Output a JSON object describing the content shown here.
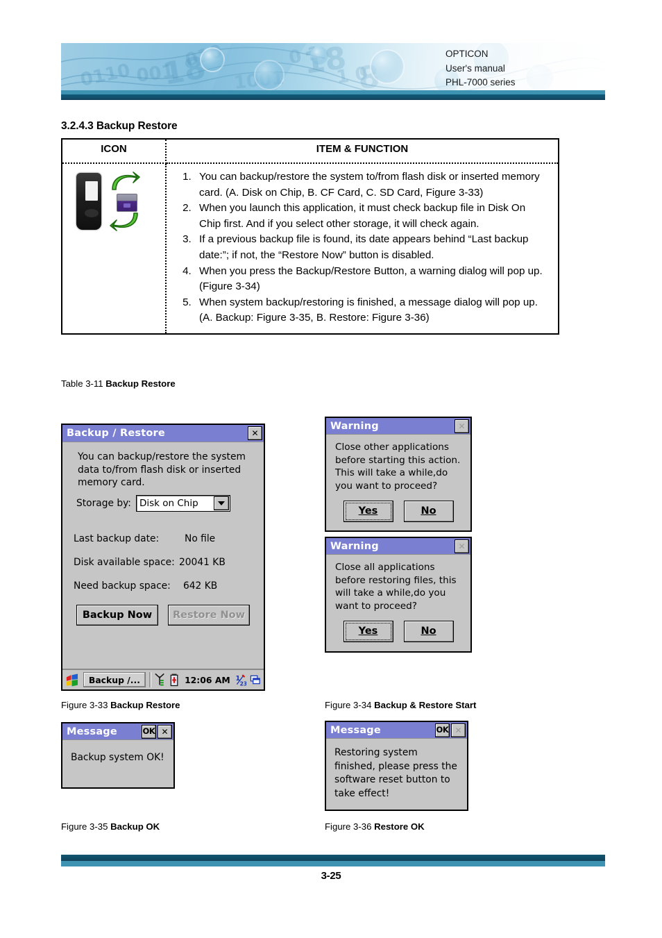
{
  "header": {
    "company": "OPTICON",
    "manual": "User's manual",
    "series": "PHL-7000 series",
    "banner_alt": "blue-circuit-binary-banner"
  },
  "section": {
    "heading": "3.2.4.3 Backup Restore"
  },
  "table": {
    "columns": [
      "ICON",
      "ITEM & FUNCTION"
    ],
    "icon_name": "backup-restore-device-sync-icon",
    "items": [
      "You can backup/restore the system to/from flash disk or inserted memory card. (A. Disk on Chip, B. CF Card, C. SD Card, Figure 3-33)",
      "When you launch this application, it must check backup file in Disk On Chip first. And if you select other storage, it will check again.",
      "If a previous backup file is found, its date appears behind “Last backup date:”; if not, the “Restore Now” button is disabled.",
      "When you press the Backup/Restore Button, a warning dialog will pop up. (Figure 3-34)",
      "When system backup/restoring is finished, a message dialog will pop up. (A. Backup: Figure 3-35, B. Restore: Figure 3-36)"
    ],
    "caption_prefix": "Table 3-11 ",
    "caption_bold": "Backup Restore"
  },
  "fig33": {
    "title": "Backup / Restore",
    "close_label": "✕",
    "intro": "You can backup/restore the system data to/from flash disk or inserted memory card.",
    "storage_label": "Storage by:",
    "storage_value": "Disk on Chip",
    "rows": [
      {
        "key": "Last backup date:",
        "value": "No file"
      },
      {
        "key": "Disk available space:",
        "value": "20041 KB"
      },
      {
        "key": "Need backup space:",
        "value": "642 KB"
      }
    ],
    "backup_button": "Backup Now",
    "restore_button": "Restore Now",
    "taskbar": {
      "start_icon": "windows-start-flag-icon",
      "task_label": "Backup /...",
      "signal_icon": "antenna-signal-icon",
      "battery_icon": "battery-icon",
      "clock": "12:06 AM",
      "input_icon": "handwriting-input-icon",
      "desktop_icon": "show-desktop-icon"
    },
    "caption_prefix": "Figure 3-33 ",
    "caption_bold": "Backup Restore"
  },
  "fig34": {
    "caption_prefix": "Figure 3-34 ",
    "caption_bold": "Backup & Restore Start",
    "dialog_a": {
      "title": "Warning",
      "close_label": "✕",
      "text": "Close other applications before starting this action. This will take a while,do you want to proceed?",
      "yes_button": "Yes",
      "no_button": "No"
    },
    "dialog_b": {
      "title": "Warning",
      "close_label": "✕",
      "text": "Close all applications before restoring files, this will take a while,do you want to proceed?",
      "yes_button": "Yes",
      "no_button": "No"
    }
  },
  "fig35": {
    "title": "Message",
    "ok_label": "OK",
    "close_label": "✕",
    "text": "Backup system OK!",
    "caption_prefix": "Figure 3-35 ",
    "caption_bold": "Backup OK"
  },
  "fig36": {
    "title": "Message",
    "ok_label": "OK",
    "close_label": "✕",
    "text": "Restoring system finished, please press the software reset button to take effect!",
    "caption_prefix": "Figure 3-36 ",
    "caption_bold": "Restore OK"
  },
  "footer": {
    "page_number": "3-25"
  },
  "colors": {
    "banner_blue": "#7dbcdc",
    "rule_dark": "#12546f",
    "rule_light": "#3e93b3",
    "titlebar": "#7b7fd2",
    "dialog_face": "#c6c6c6"
  }
}
